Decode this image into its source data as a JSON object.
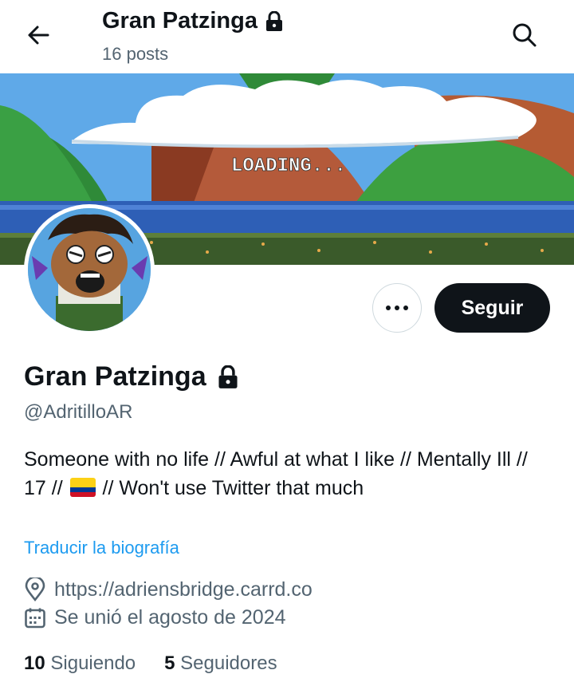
{
  "header": {
    "title": "Gran Patzinga",
    "posts_count": "16 posts",
    "back_icon": "arrow-left-icon",
    "search_icon": "search-icon"
  },
  "banner": {
    "text": "LOADING..."
  },
  "actions": {
    "more_icon": "more-dots-icon",
    "follow_label": "Seguir"
  },
  "profile": {
    "name": "Gran Patzinga",
    "protected_icon": "lock-icon",
    "handle": "@AdritilloAR",
    "bio_part1": "Someone with no life // Awful at what I like // Mentally Ill // 17 // ",
    "bio_flag": "colombia-flag",
    "bio_part2": " // Won't use Twitter that much",
    "translate_label": "Traducir la biografía",
    "website": "https://adriensbridge.carrd.co",
    "joined": "Se unió el agosto de 2024"
  },
  "stats": {
    "following_count": "10",
    "following_label": "Siguiendo",
    "followers_count": "5",
    "followers_label": "Seguidores"
  },
  "colors": {
    "link": "#1d9bf0",
    "secondary_text": "#536471",
    "primary_text": "#0f1419",
    "flag": [
      "#fcd116",
      "#003893",
      "#ce1126"
    ]
  }
}
